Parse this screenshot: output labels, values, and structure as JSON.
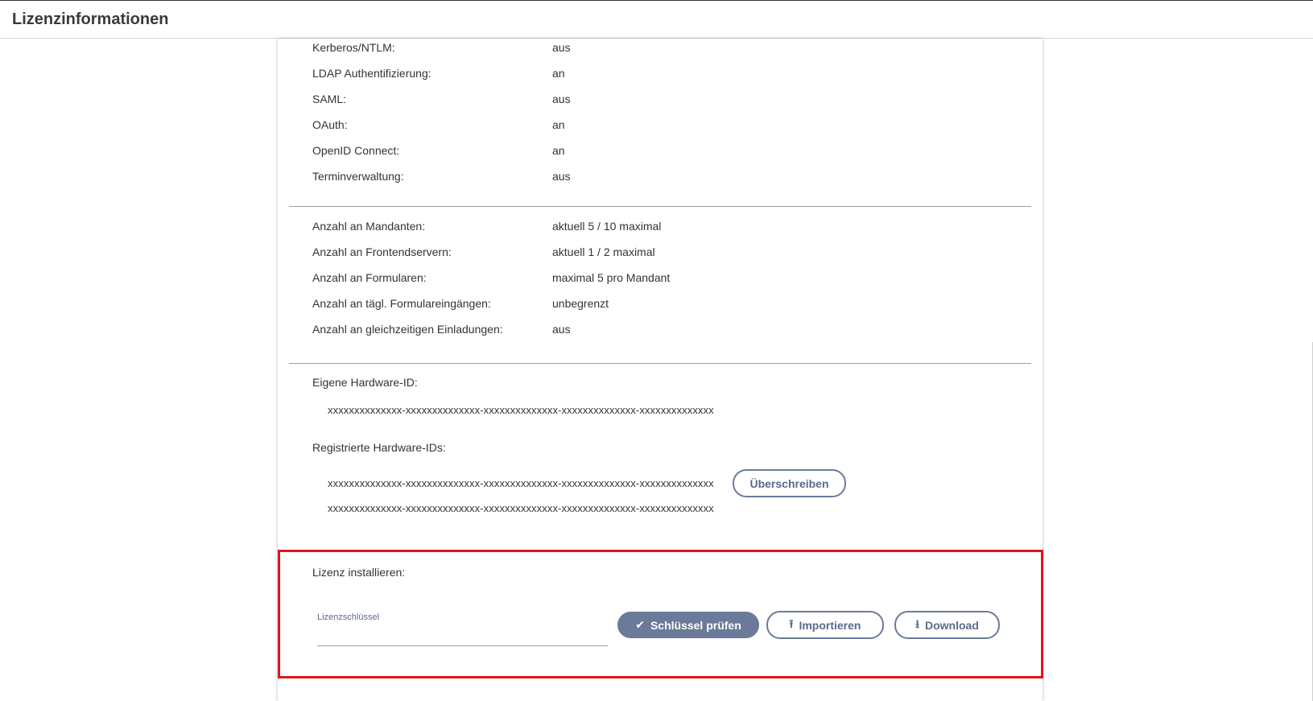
{
  "header": {
    "title": "Lizenzinformationen"
  },
  "features": [
    {
      "label": "Kerberos/NTLM:",
      "value": "aus"
    },
    {
      "label": "LDAP Authentifizierung:",
      "value": "an"
    },
    {
      "label": "SAML:",
      "value": "aus"
    },
    {
      "label": "OAuth:",
      "value": "an"
    },
    {
      "label": "OpenID Connect:",
      "value": "an"
    },
    {
      "label": "Terminverwaltung:",
      "value": "aus"
    }
  ],
  "limits": [
    {
      "label": "Anzahl an Mandanten:",
      "value": "aktuell 5 / 10 maximal"
    },
    {
      "label": "Anzahl an Frontendservern:",
      "value": "aktuell 1 / 2 maximal"
    },
    {
      "label": "Anzahl an Formularen:",
      "value": "maximal 5 pro Mandant"
    },
    {
      "label": "Anzahl an tägl. Formulareingängen:",
      "value": "unbegrenzt"
    },
    {
      "label": "Anzahl an gleichzeitigen Einladungen:",
      "value": "aus"
    }
  ],
  "hardware": {
    "own_label": "Eigene Hardware-ID:",
    "own_id": "xxxxxxxxxxxxxx-xxxxxxxxxxxxxx-xxxxxxxxxxxxxx-xxxxxxxxxxxxxx-xxxxxxxxxxxxxx",
    "registered_label": "Registrierte Hardware-IDs:",
    "registered_ids": [
      "xxxxxxxxxxxxxx-xxxxxxxxxxxxxx-xxxxxxxxxxxxxx-xxxxxxxxxxxxxx-xxxxxxxxxxxxxx",
      "xxxxxxxxxxxxxx-xxxxxxxxxxxxxx-xxxxxxxxxxxxxx-xxxxxxxxxxxxxx-xxxxxxxxxxxxxx"
    ],
    "overwrite_label": "Überschreiben"
  },
  "install": {
    "label": "Lizenz installieren:",
    "key_field_label": "Lizenzschlüssel",
    "key_value": "",
    "check_label": "Schlüssel prüfen",
    "import_label": "Importieren",
    "download_label": "Download"
  },
  "icons": {
    "check": "check-icon",
    "import": "upload-icon",
    "download": "download-icon"
  },
  "colors": {
    "button_primary": "#6b7a99",
    "highlight": "#e2141e"
  }
}
